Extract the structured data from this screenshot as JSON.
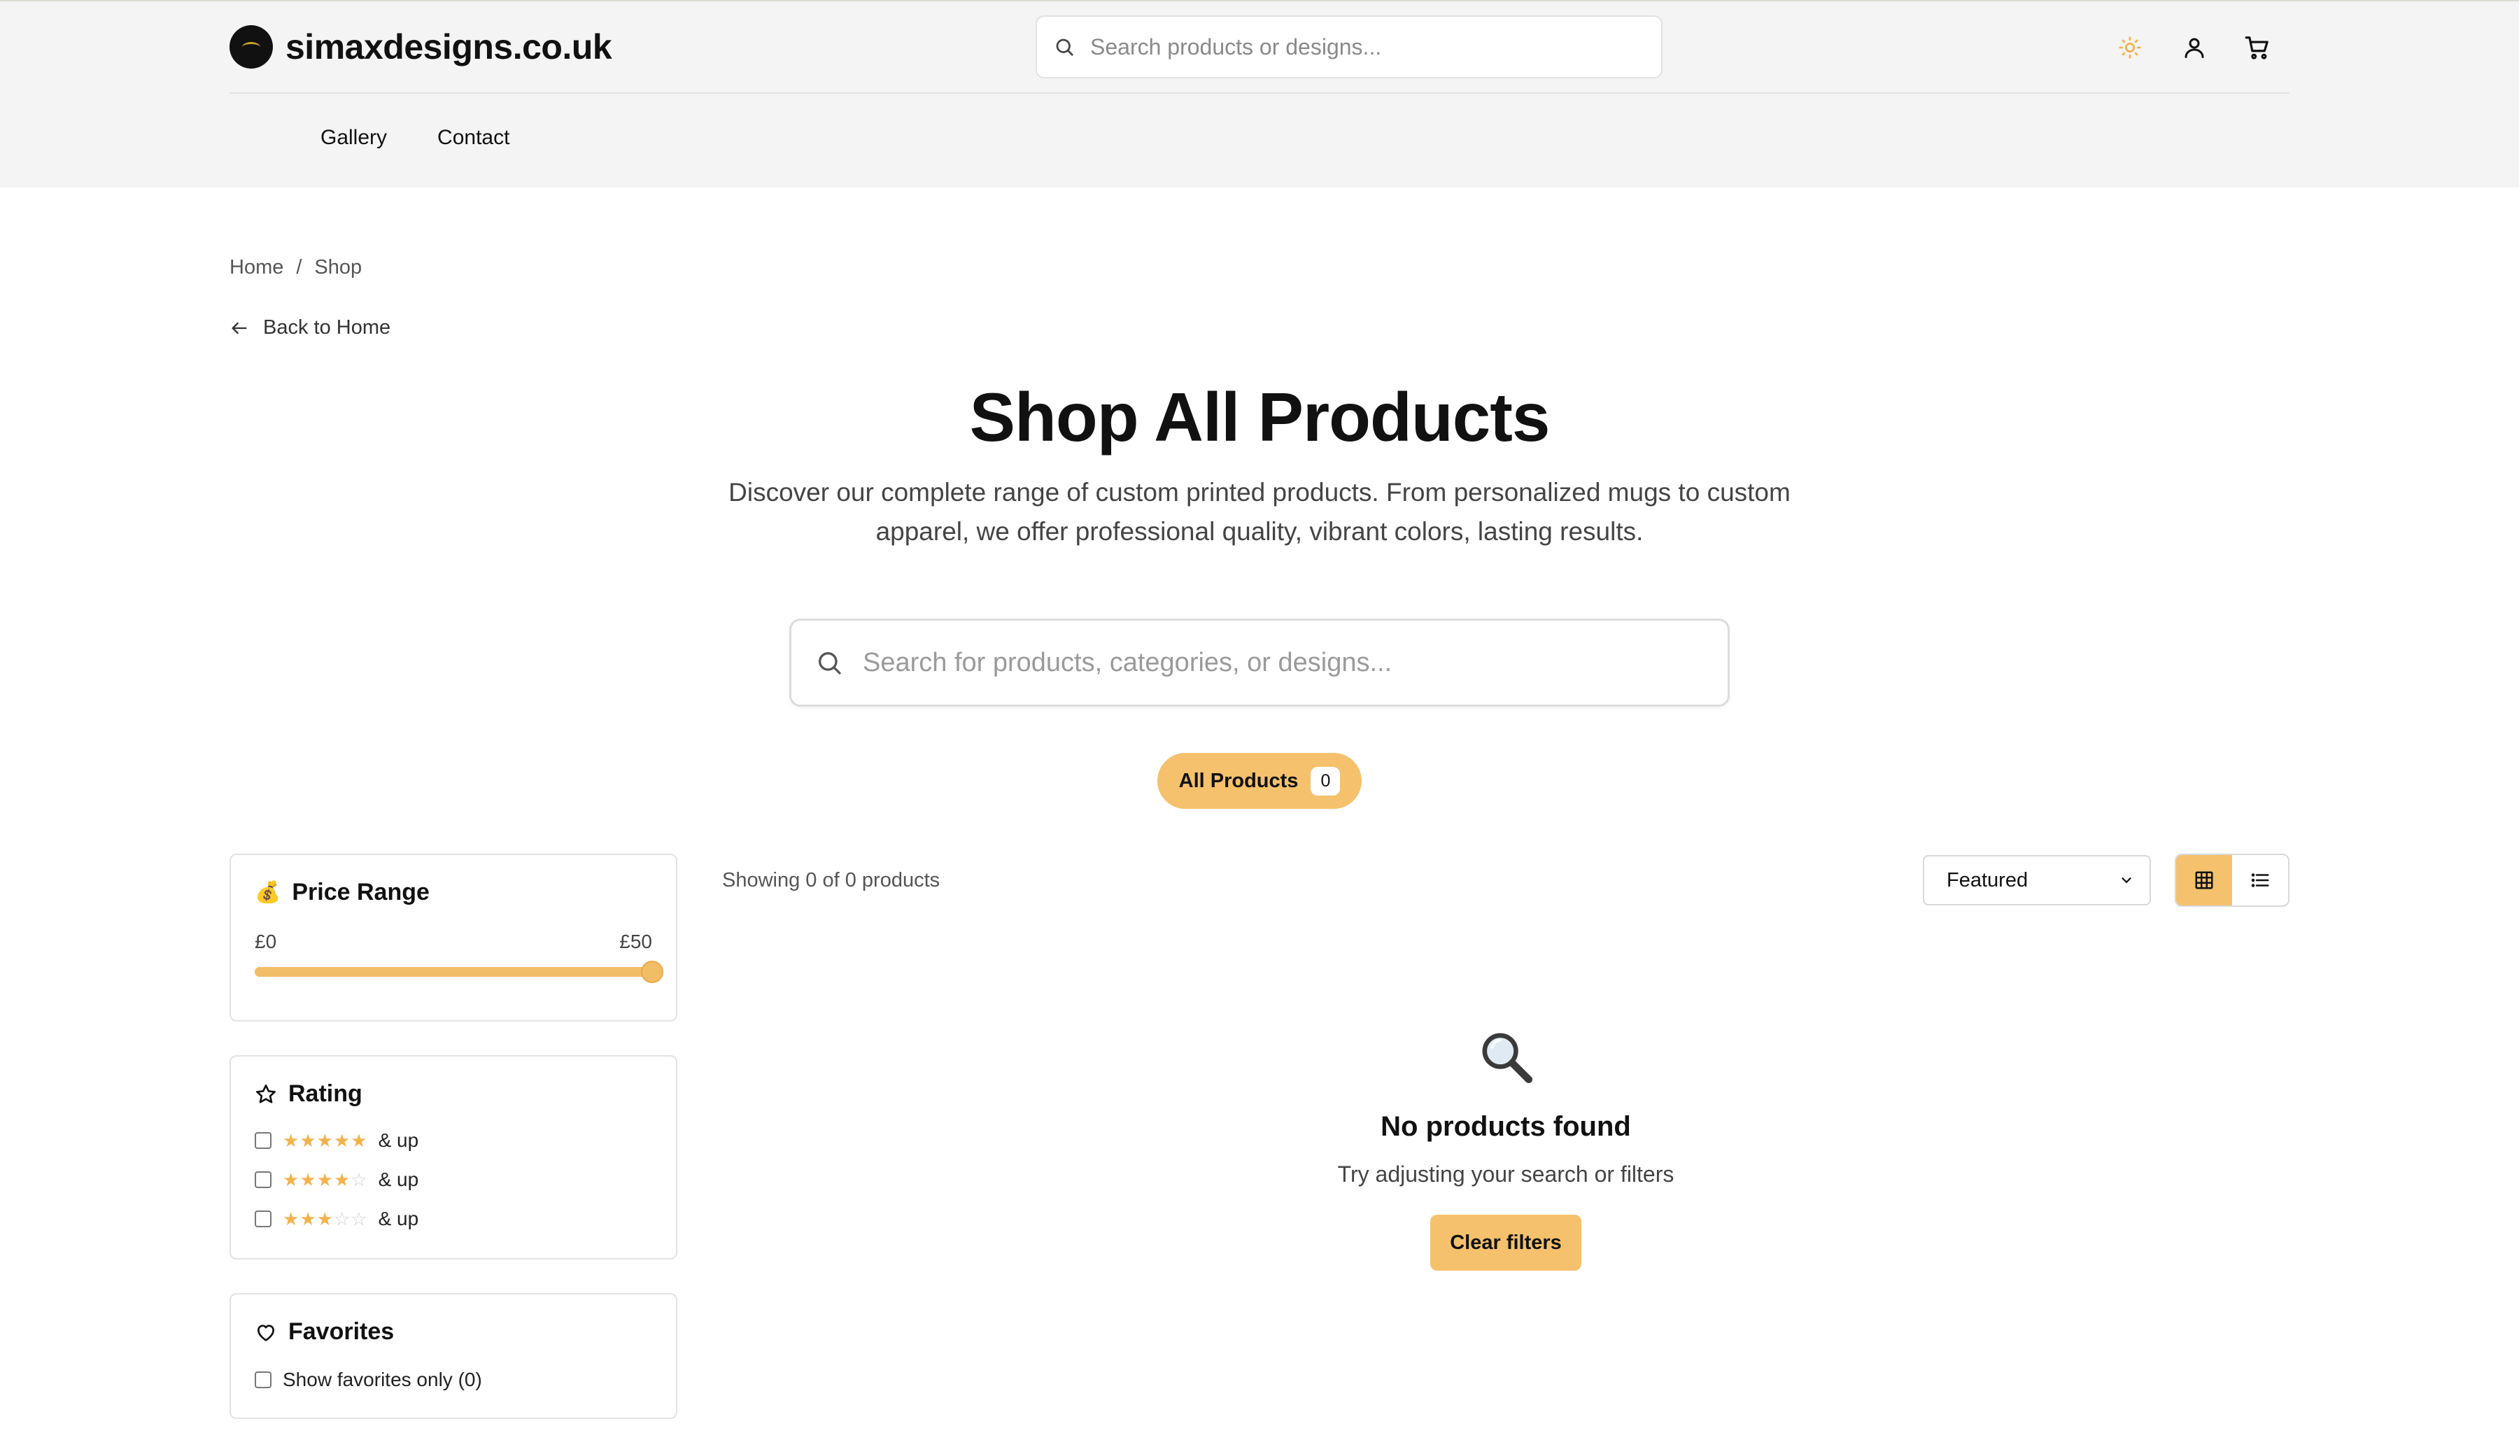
{
  "header": {
    "brand": "simaxdesigns.co.uk",
    "search_placeholder": "Search products or designs...",
    "nav": [
      {
        "label": "Gallery"
      },
      {
        "label": "Contact"
      }
    ],
    "icons": {
      "theme": "sun-icon",
      "account": "user-icon",
      "cart": "cart-icon"
    },
    "accent_color": "#f5c16c"
  },
  "breadcrumb": {
    "items": [
      "Home",
      "Shop"
    ],
    "separator": "/"
  },
  "back_link": "Back to Home",
  "hero": {
    "title": "Shop All Products",
    "subtitle": "Discover our complete range of custom printed products. From personalized mugs to custom apparel, we offer professional quality, vibrant colors, lasting results."
  },
  "main_search": {
    "placeholder": "Search for products, categories, or designs..."
  },
  "categories": [
    {
      "label": "All Products",
      "count": "0",
      "active": true
    }
  ],
  "filters": {
    "price": {
      "title": "Price Range",
      "icon": "money-bag-icon",
      "min_label": "£0",
      "max_label": "£50",
      "selected_fraction": 1.0
    },
    "rating": {
      "title": "Rating",
      "icon": "star-outline-icon",
      "options": [
        {
          "stars": 5,
          "label": "& up",
          "checked": false
        },
        {
          "stars": 4,
          "label": "& up",
          "checked": false
        },
        {
          "stars": 3,
          "label": "& up",
          "checked": false
        }
      ]
    },
    "favorites": {
      "title": "Favorites",
      "icon": "heart-icon",
      "option_label": "Show favorites only (0)",
      "checked": false
    }
  },
  "results": {
    "count_text": "Showing 0 of 0 products",
    "sort_value": "Featured",
    "view_mode": "grid",
    "empty": {
      "icon": "magnifying-glass-icon",
      "title": "No products found",
      "subtitle": "Try adjusting your search or filters",
      "button": "Clear filters"
    }
  }
}
